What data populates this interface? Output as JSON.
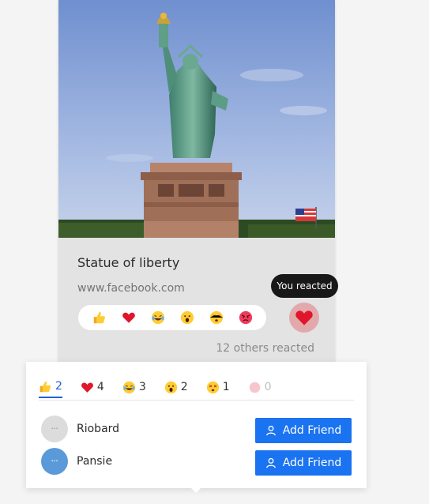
{
  "post": {
    "title": "Statue of liberty",
    "url": "www.facebook.com",
    "others_reacted": "12 others reacted",
    "tooltip": "You reacted"
  },
  "reactions": [
    {
      "icon": "thumbs-up-icon",
      "count": "2"
    },
    {
      "icon": "heart-icon",
      "count": "4"
    },
    {
      "icon": "laughing-icon",
      "count": "3"
    },
    {
      "icon": "surprised-icon",
      "count": "2"
    },
    {
      "icon": "dizzy-face-icon",
      "count": "1"
    },
    {
      "icon": "angry-face-icon",
      "count": "0"
    }
  ],
  "users": [
    {
      "name": "Riobard",
      "avatar_color": "#dcdcdc"
    },
    {
      "name": "Pansie",
      "avatar_color": "#5b9ad9"
    }
  ],
  "add_friend_label": "Add Friend",
  "colors": {
    "accent": "#1a73f0",
    "heart": "#e0162b",
    "card_bg": "#e3e3e3"
  }
}
